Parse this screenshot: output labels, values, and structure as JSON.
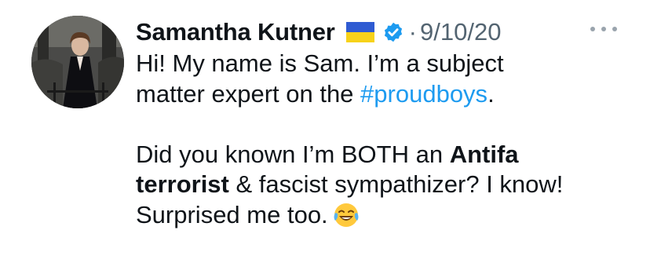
{
  "tweet": {
    "author_name": "Samantha Kutner",
    "separator": "·",
    "date": "9/10/20",
    "line1": "Hi! My name is Sam. I’m a subject",
    "line2_before": "matter expert on the ",
    "hashtag": "#proudboys",
    "line2_after": ".",
    "line3_before": "Did you known I’m BOTH an ",
    "line3_bold": "Antifa",
    "line4_bold": "terrorist",
    "line4_after": " & fascist sympathizer? I know!",
    "line5": "Surprised me too."
  },
  "icons": {
    "flag": "ukraine-flag-icon",
    "verified": "verified-badge-icon",
    "more": "more-options-icon",
    "emoji": "face-with-tears-of-joy-icon"
  },
  "colors": {
    "hashtag": "#1d9bf0",
    "verified": "#1d9bf0",
    "muted": "#536471",
    "flag_blue": "#2f5bd2",
    "flag_yellow": "#f7d21a"
  }
}
